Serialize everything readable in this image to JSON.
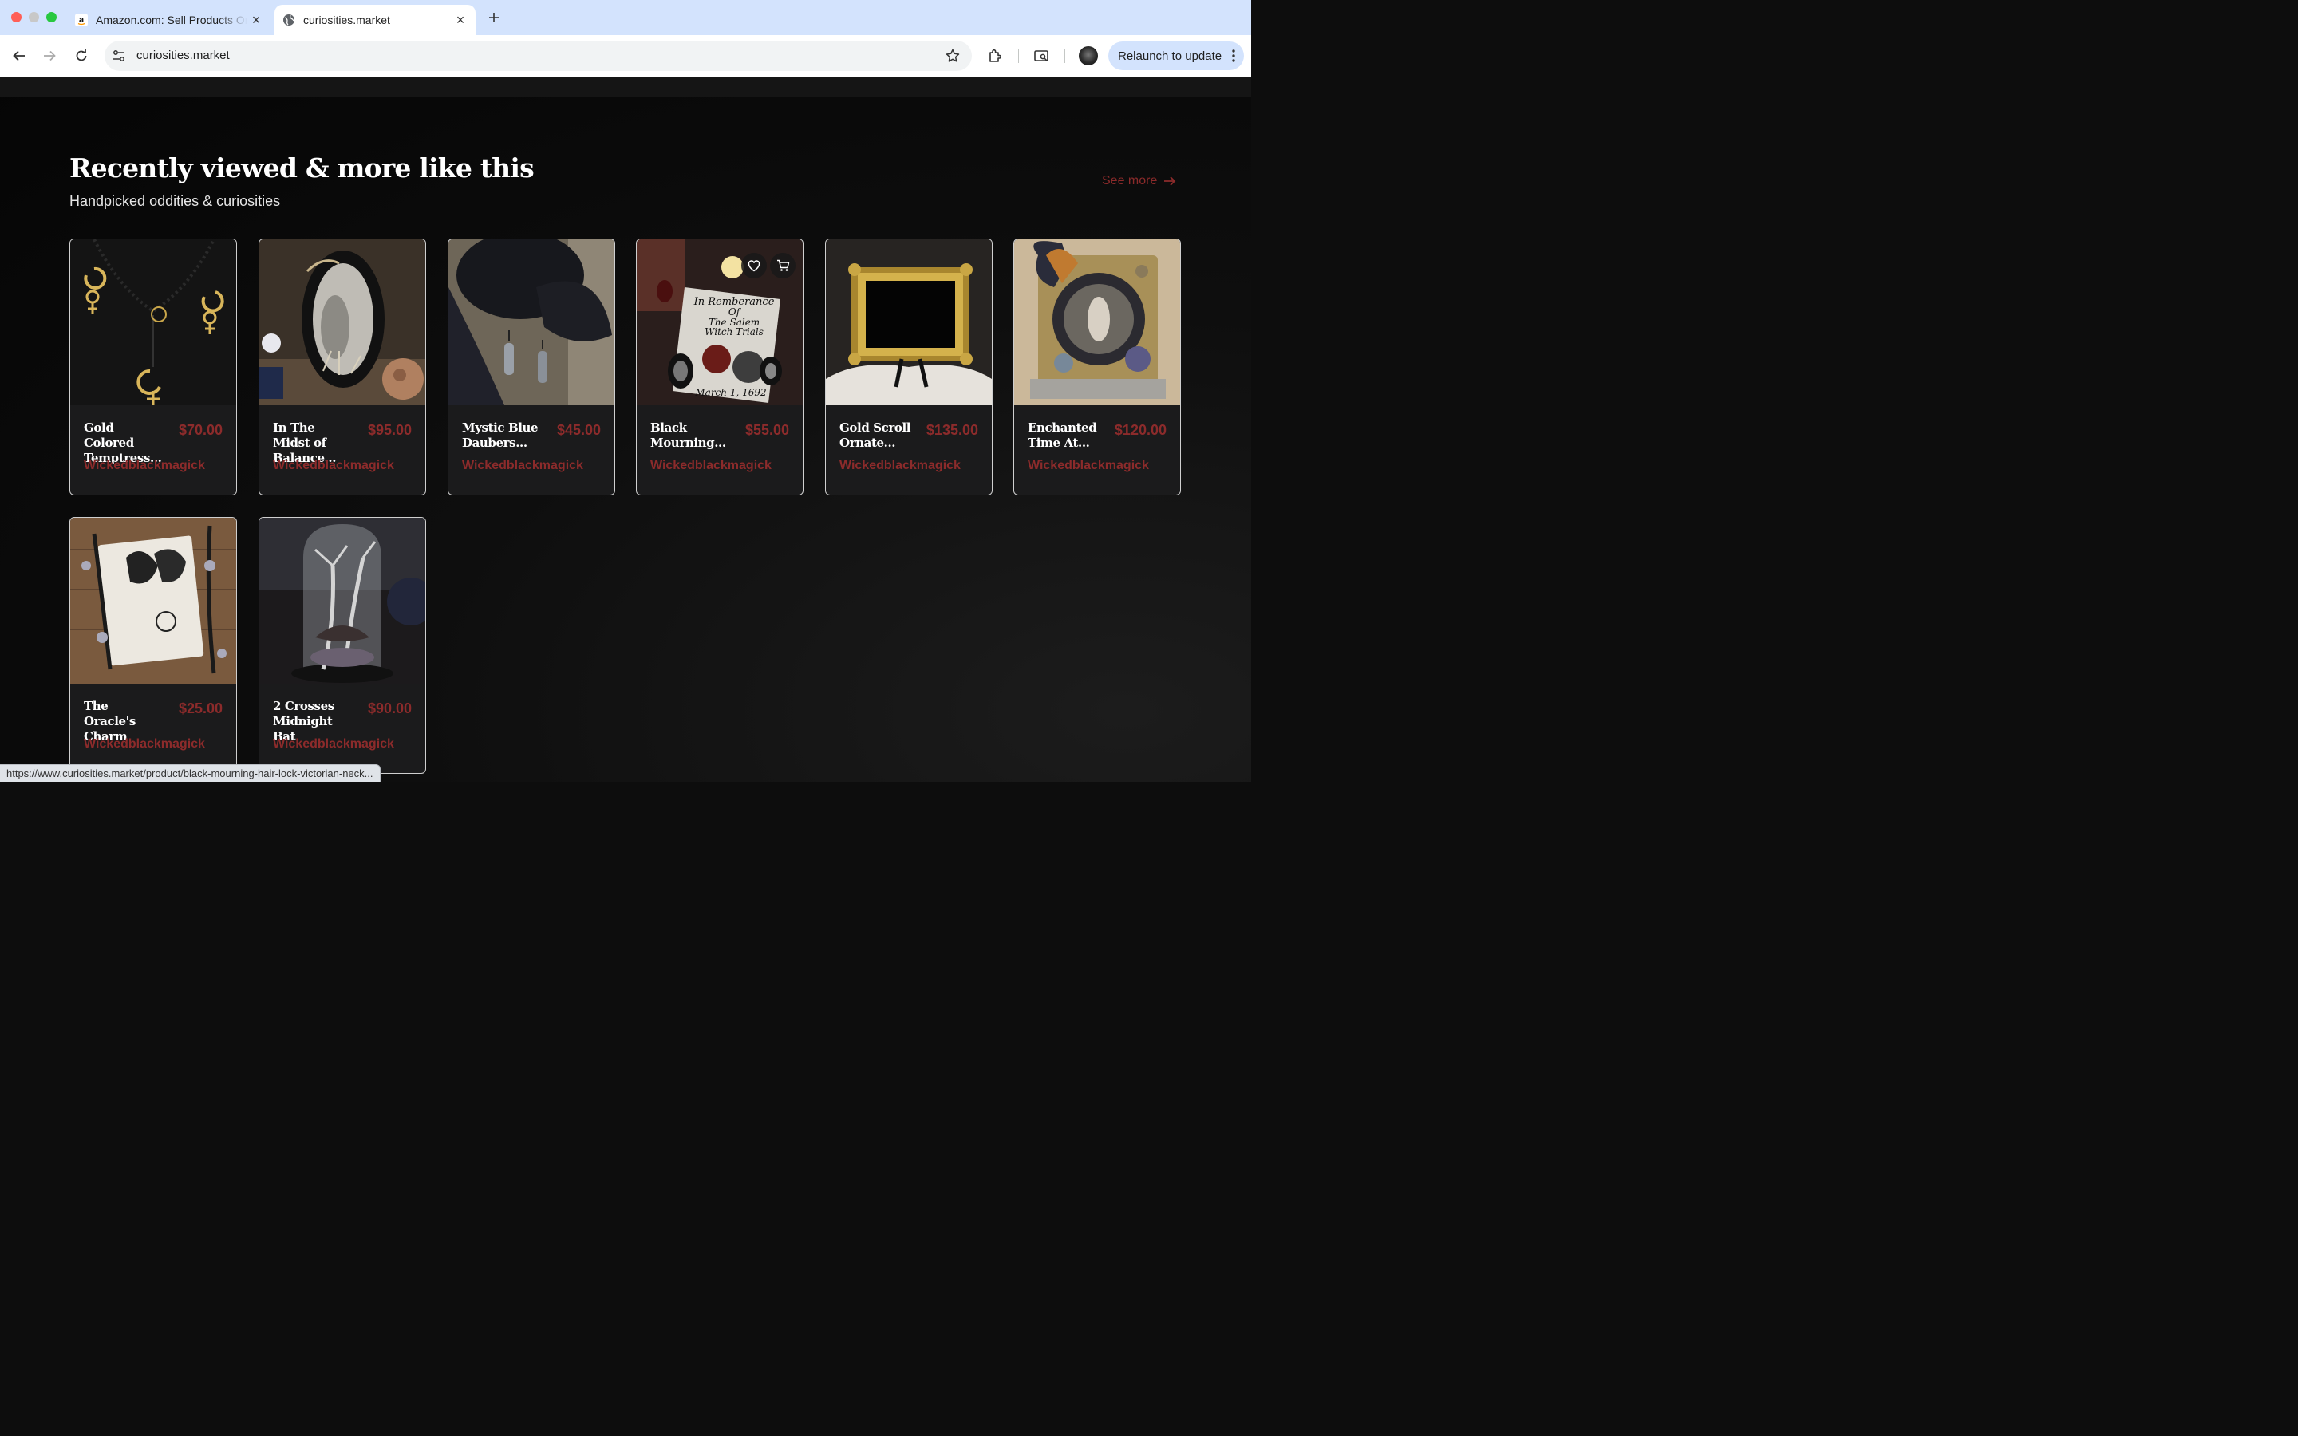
{
  "browser": {
    "tabs": [
      {
        "title": "Amazon.com: Sell Products Online",
        "favicon": "amazon-icon",
        "active": false
      },
      {
        "title": "curiosities.market",
        "favicon": "globe-icon",
        "active": true
      }
    ],
    "url": "curiosities.market",
    "relaunch_label": "Relaunch to update",
    "status_url": "https://www.curiosities.market/product/black-mourning-hair-lock-victorian-neck..."
  },
  "section": {
    "title": "Recently viewed & more like this",
    "subtitle": "Handpicked oddities & curiosities",
    "see_more": "See more"
  },
  "colors": {
    "accent": "#8c2b2b",
    "background": "#0d0d0d",
    "card": "#1b1b1c"
  },
  "products": [
    {
      "title": "Gold Colored Temptress...",
      "price": "$70.00",
      "seller": "Wickedblackmagick"
    },
    {
      "title": "In The Midst of Balance...",
      "price": "$95.00",
      "seller": "Wickedblackmagick"
    },
    {
      "title": "Mystic Blue Daubers...",
      "price": "$45.00",
      "seller": "Wickedblackmagick"
    },
    {
      "title": "Black Mourning...",
      "price": "$55.00",
      "seller": "Wickedblackmagick",
      "image_text": [
        "In Remberance",
        "Of",
        "The Salem",
        "Witch Trials",
        "March 1, 1692"
      ]
    },
    {
      "title": "Gold Scroll Ornate...",
      "price": "$135.00",
      "seller": "Wickedblackmagick"
    },
    {
      "title": "Enchanted Time At...",
      "price": "$120.00",
      "seller": "Wickedblackmagick"
    },
    {
      "title": "The Oracle's Charm",
      "price": "$25.00",
      "seller": "Wickedblackmagick"
    },
    {
      "title": "2 Crosses Midnight Bat",
      "price": "$90.00",
      "seller": "Wickedblackmagick"
    }
  ]
}
